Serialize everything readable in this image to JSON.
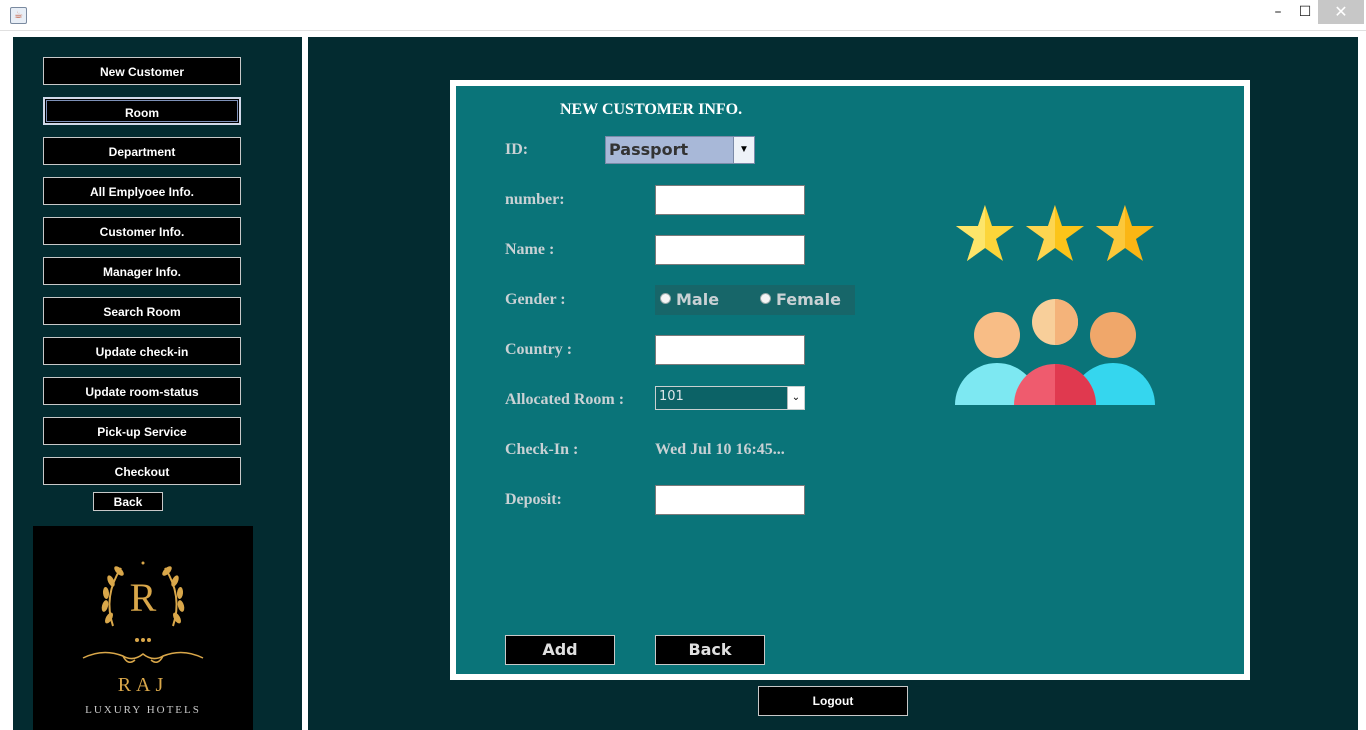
{
  "window": {
    "min_glyph": "–",
    "max_glyph": "☐",
    "close_glyph": "✕"
  },
  "sidebar": {
    "items": [
      {
        "label": "New Customer"
      },
      {
        "label": "Room"
      },
      {
        "label": "Department"
      },
      {
        "label": "All Emplyoee Info."
      },
      {
        "label": "Customer Info."
      },
      {
        "label": "Manager Info."
      },
      {
        "label": "Search Room"
      },
      {
        "label": "Update check-in"
      },
      {
        "label": "Update room-status"
      },
      {
        "label": "Pick-up Service"
      },
      {
        "label": "Checkout"
      }
    ],
    "back_label": "Back",
    "logo": {
      "letter": "R",
      "name": "RAJ",
      "subtitle": "LUXURY HOTELS"
    }
  },
  "form": {
    "title": "NEW CUSTOMER INFO.",
    "id_label": "ID:",
    "id_selected": "Passport",
    "number_label": "number:",
    "name_label": "Name :",
    "gender_label": "Gender :",
    "gender_options": [
      "Male",
      "Female"
    ],
    "country_label": "Country :",
    "room_label": "Allocated Room :",
    "room_selected": "101",
    "checkin_label": "Check-In :",
    "checkin_value": "Wed Jul 10 16:45...",
    "deposit_label": "Deposit:",
    "add_label": "Add",
    "back_label": "Back"
  },
  "logout_label": "Logout",
  "colors": {
    "background": "#032b30",
    "panel": "#0a7479",
    "star": "#fcc419",
    "person_center": "#ef5b6e",
    "person_sides": "#7de8f2"
  }
}
